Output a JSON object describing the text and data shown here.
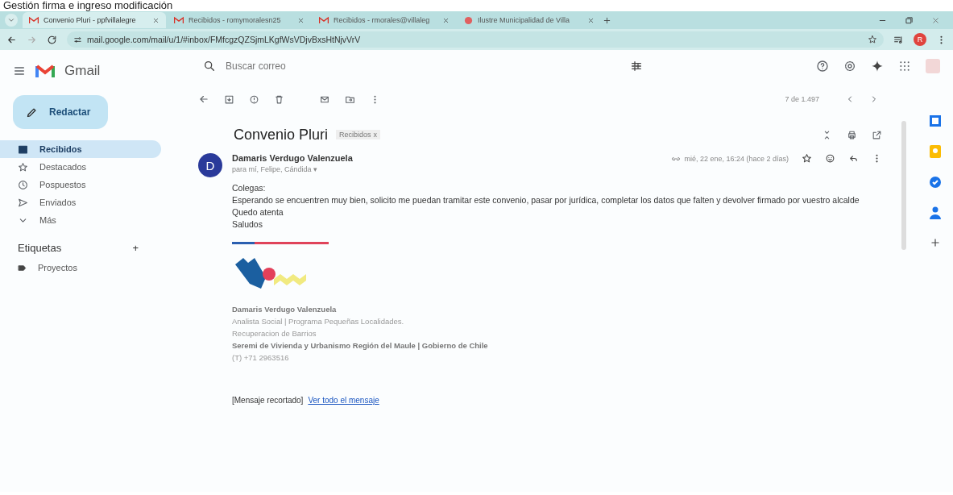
{
  "document_caption": "Gestión firma e ingreso modificación",
  "browser": {
    "tabs": [
      {
        "title": "Convenio Pluri - ppfvillalegre",
        "kind": "gmail",
        "selected": true
      },
      {
        "title": "Recibidos - romymoralesn25",
        "kind": "gmail",
        "selected": false
      },
      {
        "title": "Recibidos - rmorales@villaleg",
        "kind": "gmail",
        "selected": false
      },
      {
        "title": "Ilustre Municipalidad de Villa",
        "kind": "site",
        "selected": false
      }
    ],
    "address": "mail.google.com/mail/u/1/#inbox/FMfcgzQZSjmLKgfWsVDjvBxsHtNjvVrV",
    "profile_initial": "R"
  },
  "app_name": "Gmail",
  "search": {
    "placeholder": "Buscar correo"
  },
  "compose_label": "Redactar",
  "sidebar": {
    "items": [
      {
        "label": "Recibidos",
        "kind": "inbox",
        "selected": true
      },
      {
        "label": "Destacados",
        "kind": "star",
        "selected": false
      },
      {
        "label": "Pospuestos",
        "kind": "clock",
        "selected": false
      },
      {
        "label": "Enviados",
        "kind": "send",
        "selected": false
      },
      {
        "label": "Más",
        "kind": "chevron",
        "selected": false
      }
    ],
    "labels_heading": "Etiquetas",
    "labels_add": "+",
    "labels": [
      {
        "label": "Proyectos"
      }
    ]
  },
  "message": {
    "counter": "7 de 1.497",
    "subject": "Convenio Pluri",
    "label_chip": "Recibidos",
    "label_chip_close": "x",
    "sender": "Damaris Verdugo Valenzuela",
    "avatar_initial": "D",
    "recipients": "para mí, Felipe, Cándida",
    "recipients_menu": "▾",
    "date": "mié, 22 ene, 16:24 (hace 2 días)",
    "body": [
      "Colegas:",
      "Esperando se encuentren muy bien, solicito me puedan tramitar este convenio, pasar por jurídica, completar los datos que falten y devolver firmado por vuestro alcalde",
      "Quedo atenta",
      "Saludos"
    ],
    "signature": [
      {
        "text": "Damaris Verdugo Valenzuela",
        "bold": true
      },
      {
        "text": "Analista Social | Programa Pequeñas Localidades.",
        "bold": false
      },
      {
        "text": "Recuperacion de Barrios",
        "bold": false
      },
      {
        "text": "Seremi de Vivienda y Urbanismo Región del Maule | Gobierno de Chile",
        "bold": true
      },
      {
        "text": "(T) +71 2963516",
        "bold": false
      }
    ],
    "clipped_note": "[Mensaje recortado]",
    "view_all_link": "Ver todo el mensaje"
  }
}
